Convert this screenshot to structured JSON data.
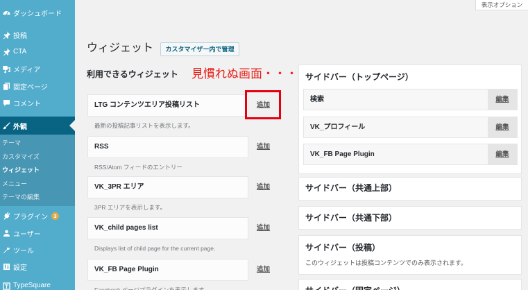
{
  "colors": {
    "menu_bg": "#52accc",
    "menu_current_bg": "#096484",
    "submenu_bg": "#4796b3",
    "badge_bg": "#e1a948",
    "page_bg": "#f1f1f1",
    "annotation": "#e8221b",
    "highlight_box": "#e4000f"
  },
  "screen_options": {
    "label": "表示オプション"
  },
  "sidebar": {
    "items": [
      {
        "label": "ダッシュボード",
        "icon": "dashboard-icon"
      },
      {
        "label": "投稿",
        "icon": "pin-icon"
      },
      {
        "label": "CTA",
        "icon": "pin-icon"
      },
      {
        "label": "メディア",
        "icon": "media-icon"
      },
      {
        "label": "固定ページ",
        "icon": "page-icon"
      },
      {
        "label": "コメント",
        "icon": "comment-icon"
      },
      {
        "label": "外観",
        "icon": "brush-icon"
      },
      {
        "label": "プラグイン",
        "icon": "plugin-icon",
        "badge": "3"
      },
      {
        "label": "ユーザー",
        "icon": "users-icon"
      },
      {
        "label": "ツール",
        "icon": "tools-icon"
      },
      {
        "label": "設定",
        "icon": "settings-icon"
      },
      {
        "label": "TypeSquare",
        "icon": "typesquare-icon"
      }
    ],
    "submenu": [
      {
        "label": "テーマ"
      },
      {
        "label": "カスタマイズ"
      },
      {
        "label": "ウィジェット"
      },
      {
        "label": "メニュー"
      },
      {
        "label": "テーマの編集"
      }
    ]
  },
  "header": {
    "title": "ウィジェット",
    "manage_button": "カスタマイザー内で管理"
  },
  "annotation": {
    "text": "見慣れぬ画面・・・"
  },
  "available_widgets": {
    "heading": "利用できるウィジェット",
    "add_label": "追加",
    "widgets": [
      {
        "title": "LTG コンテンツエリア投稿リスト",
        "description": "最新の投稿記事リストを表示します。"
      },
      {
        "title": "RSS",
        "description": "RSS/Atom フィードのエントリー"
      },
      {
        "title": "VK_3PR エリア",
        "description": "3PR エリアを表示します。"
      },
      {
        "title": "VK_child pages list",
        "description": "Displays list of child page for the current page."
      },
      {
        "title": "VK_FB Page Plugin",
        "description": "Facebook ページプラグインを表示します。"
      }
    ]
  },
  "edit_label": "編集",
  "sidebars": [
    {
      "title": "サイドバー（トップページ）",
      "widgets": [
        {
          "title": "検索"
        },
        {
          "title": "VK_プロフィール"
        },
        {
          "title": "VK_FB Page Plugin"
        }
      ]
    },
    {
      "title": "サイドバー（共通上部）"
    },
    {
      "title": "サイドバー（共通下部）"
    },
    {
      "title": "サイドバー（投稿）",
      "description": "このウィジェットは投稿コンテンツでのみ表示されます。"
    },
    {
      "title": "サイドバー（固定ページ）"
    }
  ]
}
